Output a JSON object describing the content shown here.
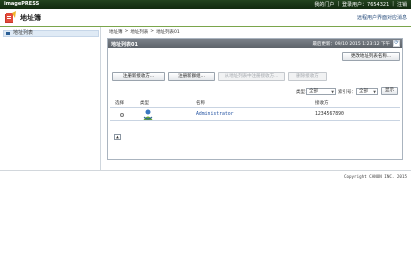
{
  "topbar": {
    "brand": "imagePRESS",
    "menu": [
      "我的门户",
      "登录用户：7654321",
      "注销"
    ]
  },
  "header": {
    "title": "地址簿",
    "right_link": "远程用户界面对应消息"
  },
  "sidebar": {
    "items": [
      {
        "label": "地址列表"
      }
    ]
  },
  "breadcrumb": [
    "地址簿",
    "地址列表",
    "地址列表01"
  ],
  "panel": {
    "title": "地址列表01",
    "updated": "最后更新：09/10 2015 1:23:12 下午",
    "rename_button": "更改地址列表名称..."
  },
  "actions": {
    "register_new": "注册新接收方...",
    "register_group": "注册新群组...",
    "register_from_list": "从地址列表中注册接收方...",
    "delete": "删除接收方"
  },
  "filter": {
    "type_label": "类型：",
    "type_value": "全部",
    "index_label": "索引号：",
    "index_value": "全部",
    "show_button": "显示"
  },
  "table": {
    "columns": [
      "选择",
      "类型",
      "名称",
      "接收方"
    ],
    "rows": [
      {
        "name": "Administrator",
        "destination": "1234567890",
        "type_icon": "user-icon"
      }
    ]
  },
  "top_button": "top",
  "footer": {
    "copyright": "Copyright CANON INC. 2015"
  }
}
